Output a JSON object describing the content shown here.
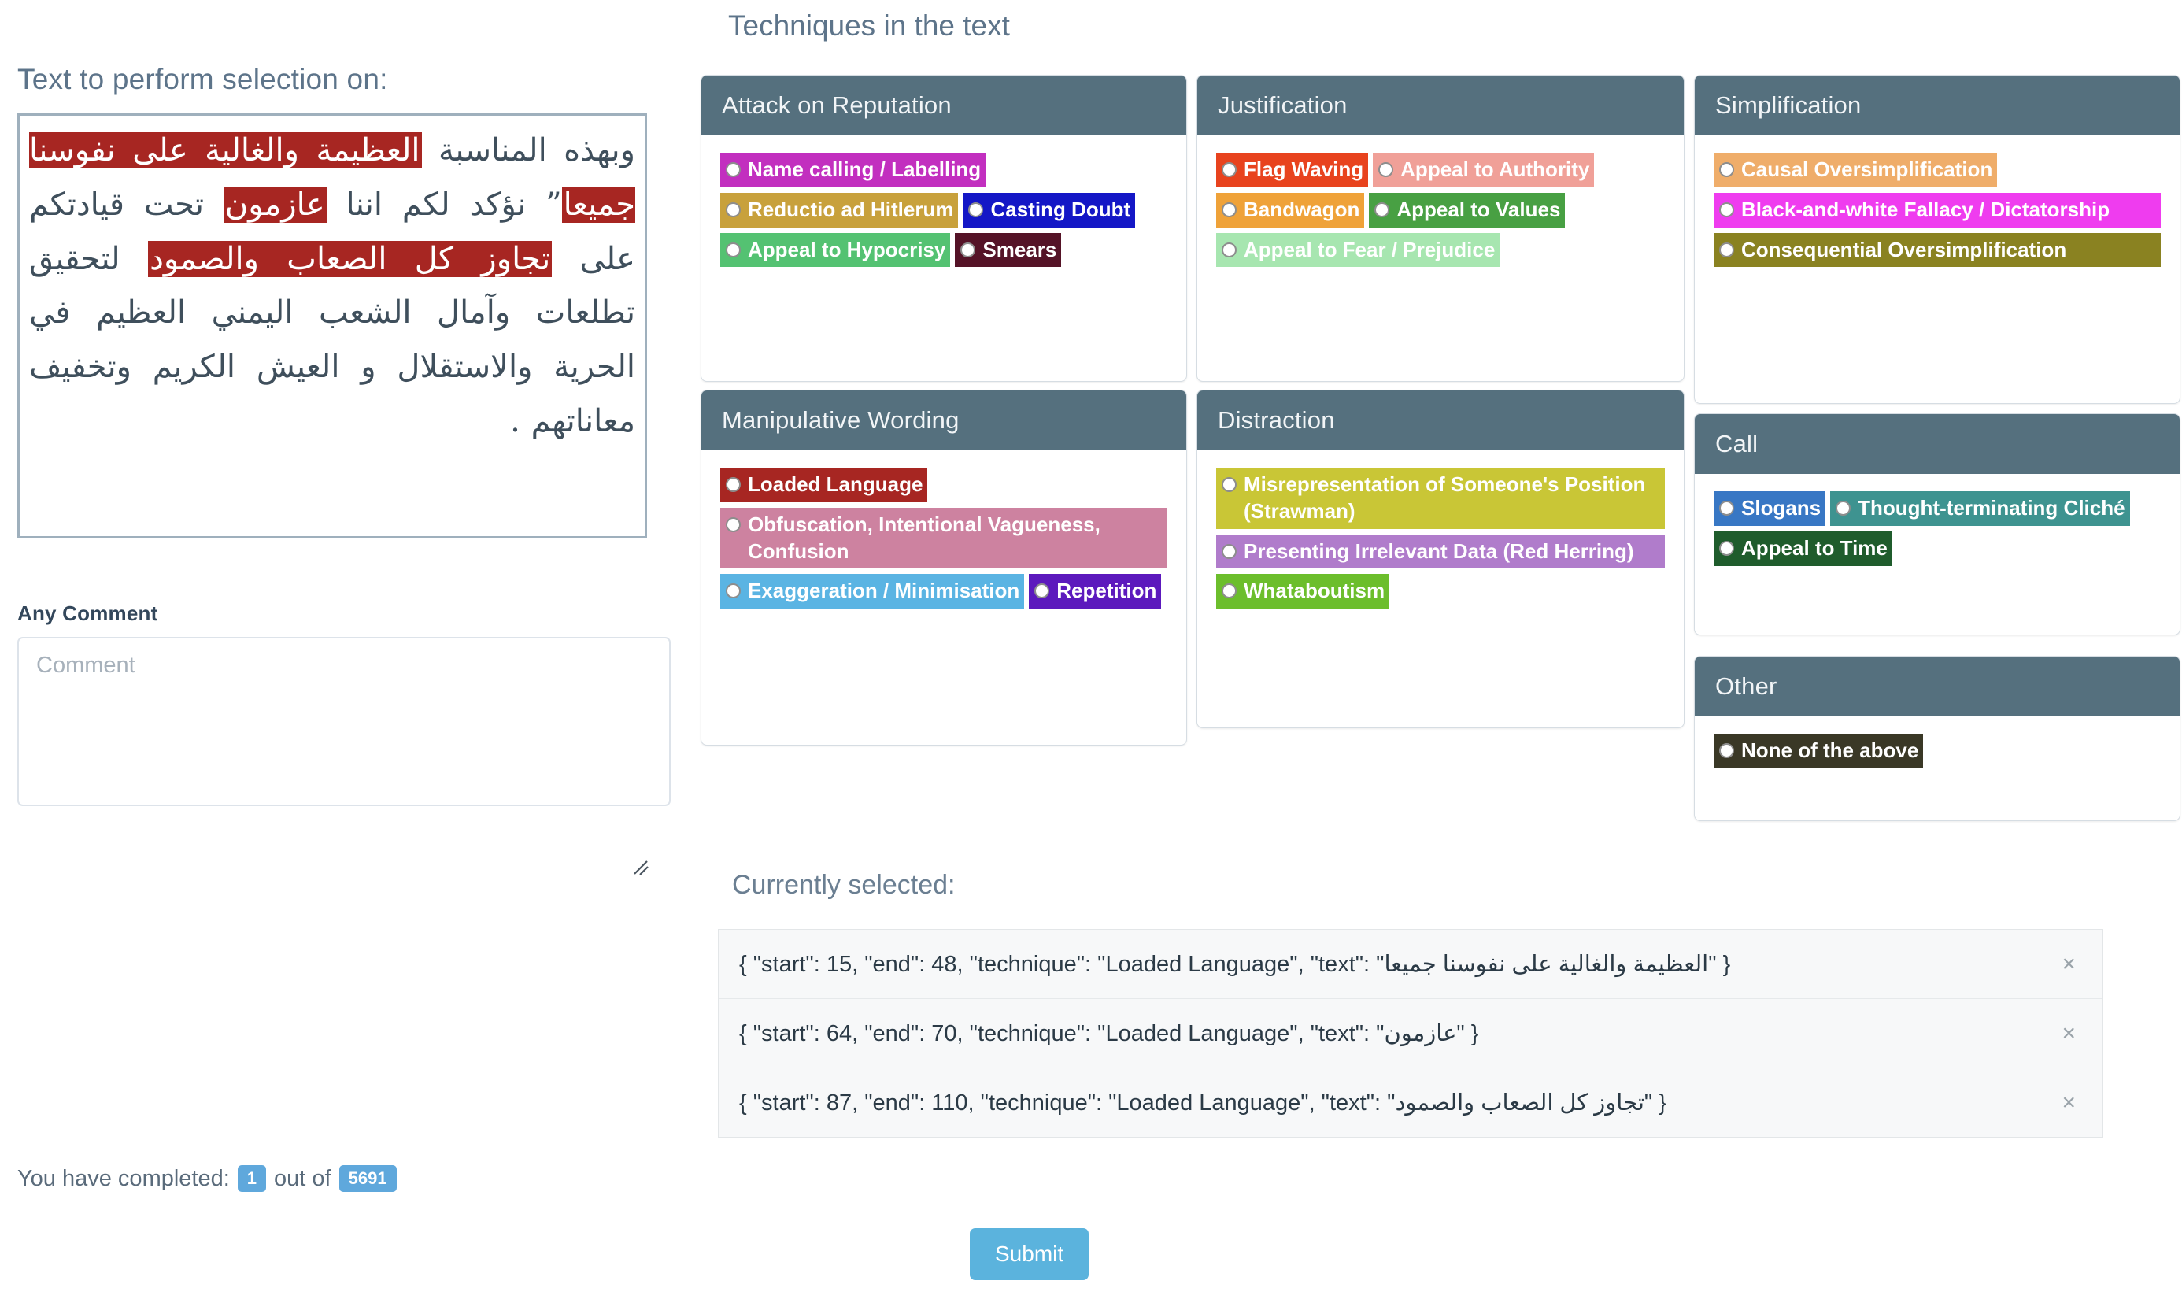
{
  "left": {
    "text_label": "Text to perform selection on:",
    "article_segments": [
      {
        "text": "وبهذه المناسبة ",
        "highlight": false
      },
      {
        "text": "العظيمة والغالية على نفوسنا جميعا",
        "highlight": true
      },
      {
        "text": "” نؤكد لكم اننا ",
        "highlight": false
      },
      {
        "text": "عازمون",
        "highlight": true
      },
      {
        "text": " تحت قيادتكم على ",
        "highlight": false
      },
      {
        "text": "تجاوز كل الصعاب والصمود",
        "highlight": true
      },
      {
        "text": " لتحقيق تطلعات وآمال الشعب اليمني العظيم في الحرية والاستقلال و العيش الكريم وتخفيف معاناتهم .",
        "highlight": false
      }
    ],
    "comment_label": "Any Comment",
    "comment_placeholder": "Comment",
    "comment_value": "",
    "completed_prefix": "You have completed:",
    "completed_count": "1",
    "completed_middle": "out of",
    "completed_total": "5691"
  },
  "techniques": {
    "title": "Techniques in the text",
    "cards": [
      {
        "title": "Attack on Reputation",
        "items": [
          {
            "label": "Name calling / Labelling",
            "color": "#c22fbf",
            "wide": false
          },
          {
            "label": "Reductio ad Hitlerum",
            "color": "#c8a13c",
            "wide": false
          },
          {
            "label": "Casting Doubt",
            "color": "#1417c6",
            "wide": false
          },
          {
            "label": "Appeal to Hypocrisy",
            "color": "#54c272",
            "wide": false
          },
          {
            "label": "Smears",
            "color": "#551327",
            "wide": false
          }
        ]
      },
      {
        "title": "Justification",
        "items": [
          {
            "label": "Flag Waving",
            "color": "#e8431e",
            "wide": false
          },
          {
            "label": "Appeal to Authority",
            "color": "#f0a098",
            "wide": false
          },
          {
            "label": "Bandwagon",
            "color": "#efa239",
            "wide": false
          },
          {
            "label": "Appeal to Values",
            "color": "#48a043",
            "wide": false
          },
          {
            "label": "Appeal to Fear / Prejudice",
            "color": "#a7e6b0",
            "wide": false
          }
        ]
      },
      {
        "title": "Simplification",
        "items": [
          {
            "label": "Causal Oversimplification",
            "color": "#efad6a",
            "wide": false
          },
          {
            "label": "Black-and-white Fallacy / Dictatorship",
            "color": "#ef3cef",
            "wide": true
          },
          {
            "label": "Consequential Oversimplification",
            "color": "#8a8221",
            "wide": true
          }
        ]
      },
      {
        "title": "Manipulative Wording",
        "items": [
          {
            "label": "Loaded Language",
            "color": "#a72622",
            "wide": false
          },
          {
            "label": "Obfuscation, Intentional Vagueness, Confusion",
            "color": "#cd82a0",
            "wide": true
          },
          {
            "label": "Exaggeration / Minimisation",
            "color": "#5ab4e3",
            "wide": false
          },
          {
            "label": "Repetition",
            "color": "#5c19bd",
            "wide": false
          }
        ]
      },
      {
        "title": "Distraction",
        "items": [
          {
            "label": "Misrepresentation of Someone's Position (Strawman)",
            "color": "#c9c636",
            "wide": true
          },
          {
            "label": "Presenting Irrelevant Data (Red Herring)",
            "color": "#b07ccb",
            "wide": true
          },
          {
            "label": "Whataboutism",
            "color": "#6cbe2c",
            "wide": false
          }
        ]
      },
      {
        "title": "Call",
        "items": [
          {
            "label": "Slogans",
            "color": "#3877c4",
            "wide": false
          },
          {
            "label": "Thought-terminating Cliché",
            "color": "#3e9390",
            "wide": false
          },
          {
            "label": "Appeal to Time",
            "color": "#1f5c2c",
            "wide": false
          }
        ]
      },
      {
        "title": "Other",
        "items": [
          {
            "label": "None of the above",
            "color": "#3a3826",
            "wide": false
          }
        ]
      }
    ]
  },
  "selection": {
    "title": "Currently selected:",
    "close_icon": "×",
    "items": [
      {
        "text": "{ \"start\": 15, \"end\": 48, \"technique\": \"Loaded Language\", \"text\": \"العظيمة والغالية على نفوسنا جميعا\" }"
      },
      {
        "text": "{ \"start\": 64, \"end\": 70, \"technique\": \"Loaded Language\", \"text\": \"عازمون\" }"
      },
      {
        "text": "{ \"start\": 87, \"end\": 110, \"technique\": \"Loaded Language\", \"text\": \"تجاوز كل الصعاب والصمود\" }"
      }
    ]
  },
  "submit": {
    "label": "Submit"
  },
  "colors": {
    "card_header": "#55707e",
    "heading_text": "#5d748a",
    "badge_blue": "#5fa8dc",
    "submit_blue": "#5bb3dd",
    "highlight_red": "#a72622"
  }
}
